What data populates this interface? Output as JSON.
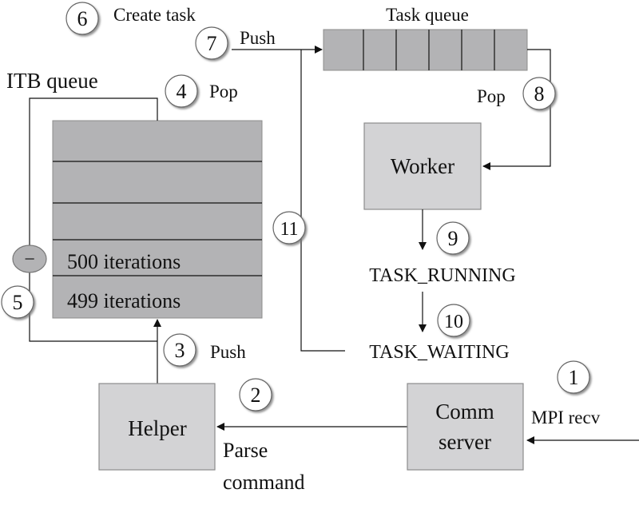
{
  "diagram": {
    "colors": {
      "queue_fill": "#b3b3b5",
      "box_fill": "#d3d3d5",
      "box_stroke": "#8c8c8c",
      "line": "#111111",
      "badge_fill": "#ffffff",
      "minus_fill": "#b3b3b5"
    },
    "labels": {
      "create_task": "Create task",
      "push_7": "Push",
      "task_queue": "Task queue",
      "itb_queue": "ITB queue",
      "pop_4": "Pop",
      "pop_8": "Pop",
      "worker": "Worker",
      "task_running": "TASK_RUNNING",
      "task_waiting": "TASK_WAITING",
      "push_3": "Push",
      "helper": "Helper",
      "parse": "Parse",
      "command": "command",
      "comm": "Comm",
      "server": "server",
      "mpi_recv": "MPI recv",
      "minus": "−"
    },
    "itb_rows": [
      "",
      "",
      "",
      "500 iterations",
      "499 iterations"
    ],
    "task_queue_cells": 6,
    "steps": {
      "s1": "1",
      "s2": "2",
      "s3": "3",
      "s4": "4",
      "s5": "5",
      "s6": "6",
      "s7": "7",
      "s8": "8",
      "s9": "9",
      "s10": "10",
      "s11": "11"
    }
  }
}
